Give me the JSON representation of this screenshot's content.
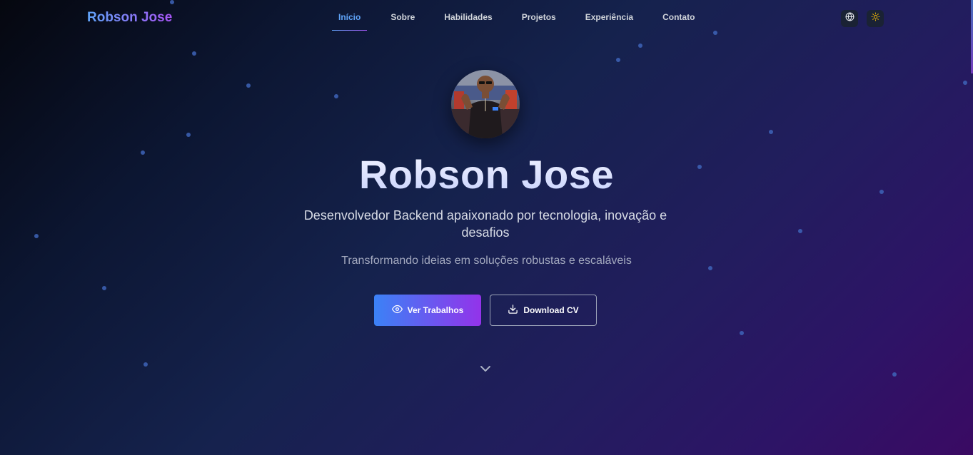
{
  "nav": {
    "brand": "Robson Jose",
    "items": [
      {
        "label": "Início"
      },
      {
        "label": "Sobre"
      },
      {
        "label": "Habilidades"
      },
      {
        "label": "Projetos"
      },
      {
        "label": "Experiência"
      },
      {
        "label": "Contato"
      }
    ],
    "active_index": 0,
    "language_icon": "globe-icon",
    "theme_icon": "sun-icon"
  },
  "hero": {
    "title": "Robson Jose",
    "subtitle": "Desenvolvedor Backend apaixonado por tecnologia, inovação e desafios",
    "tagline": "Transformando ideias em soluções robustas e escaláveis",
    "primary_button": {
      "label": "Ver Trabalhos",
      "icon": "eye-icon"
    },
    "secondary_button": {
      "label": "Download CV",
      "icon": "download-icon"
    },
    "scroll_icon": "chevron-down-icon"
  },
  "colors": {
    "accent_blue": "#60a5fa",
    "accent_purple": "#a855f7",
    "theme_icon_color": "#eab308"
  }
}
